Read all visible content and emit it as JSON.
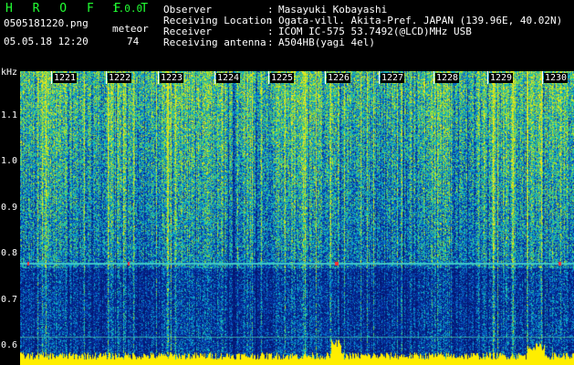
{
  "header": {
    "app_title": "H R O F F T",
    "app_version": "1.0.0",
    "file_name": "0505181220.png",
    "meteor_label": "meteor",
    "datetime": "05.05.18 12:20",
    "meteor_count": "74"
  },
  "info": [
    {
      "label": "Observer",
      "value": "Masayuki Kobayashi"
    },
    {
      "label": "Receiving Location",
      "value": "Ogata-vill. Akita-Pref. JAPAN (139.96E, 40.02N)"
    },
    {
      "label": "Receiver",
      "value": "ICOM IC-575 53.7492(@LCD)MHz USB"
    },
    {
      "label": "Receiving antenna",
      "value": "A504HB(yagi 4el)"
    }
  ],
  "colon": ":",
  "y_axis": {
    "unit": "kHz",
    "ticks": [
      "1.1",
      "1.0",
      "0.9",
      "0.8",
      "0.7",
      "0.6"
    ],
    "values": [
      1.1,
      1.0,
      0.9,
      0.8,
      0.7,
      0.6
    ]
  },
  "x_axis": {
    "ticks": [
      "1221",
      "1222",
      "1223",
      "1224",
      "1225",
      "1226",
      "1227",
      "1228",
      "1229",
      "1230"
    ]
  },
  "colors": {
    "title_green": "#22ff33",
    "waterfall_base": "#0a1fa0",
    "trace_yellow": "#ffee00",
    "carrier_line": "#40c8c8"
  }
}
